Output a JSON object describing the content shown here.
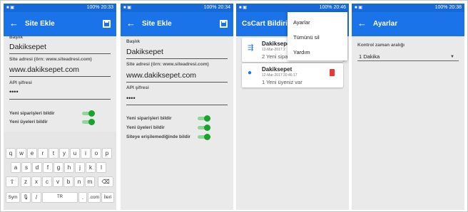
{
  "status": {
    "s1": "100% 20:33",
    "s2": "100% 20:34",
    "s3": "100% 20:46",
    "s4": "100% 20:38",
    "icons": "■ ▣"
  },
  "s1": {
    "title": "Site Ekle",
    "baslik_label": "Başlık",
    "baslik_value": "Dakiksepet",
    "adres_label": "Site adresi (örn: www.siteadresi.com)",
    "adres_value": "www.dakiksepet.com",
    "api_label": "API şifresi",
    "api_value": "••••",
    "toggles": [
      {
        "label": "Yeni siparişleri bildir",
        "on": true
      },
      {
        "label": "Yeni üyeleri bildir",
        "on": true
      }
    ],
    "keyboard": {
      "rows": [
        [
          "q",
          "w",
          "e",
          "r",
          "t",
          "y",
          "u",
          "i",
          "o",
          "p"
        ],
        [
          "a",
          "s",
          "d",
          "f",
          "g",
          "h",
          "j",
          "k",
          "l"
        ],
        [
          "z",
          "x",
          "c",
          "v",
          "b",
          "n",
          "m"
        ]
      ],
      "shift": "⇧",
      "backspace": "⌫",
      "sym": "Sym",
      "mic": "🎙",
      "slash": "/",
      "space": "TR",
      "dot": ".",
      "com": ".com",
      "next": "İleri"
    }
  },
  "s2": {
    "title": "Site Ekle",
    "baslik_label": "Başlık",
    "baslik_value": "Dakiksepet",
    "adres_label": "Site adresi (örn: www.siteadresi.com)",
    "adres_value": "www.dakiksepet.com",
    "api_label": "API şifresi",
    "api_value": "••••",
    "toggles": [
      {
        "label": "Yeni siparişleri bildir",
        "on": true
      },
      {
        "label": "Yeni üyeleri bildir",
        "on": true
      },
      {
        "label": "Siteye erişilemediğinde bildir",
        "on": true
      }
    ]
  },
  "s3": {
    "title": "CsCart Bildirimle",
    "cards": [
      {
        "name": "Dakiksepe",
        "date": "12-Mar-2017 2",
        "text": "2 Yeni sipar"
      },
      {
        "name": "Dakiksepet",
        "date": "12-Mar-2017 20:46:17",
        "text": "1 Yeni üyeniz var"
      }
    ],
    "menu": [
      "Ayarlar",
      "Tümünü sil",
      "Yardım"
    ]
  },
  "s4": {
    "title": "Ayarlar",
    "label": "Kontrol zaman aralığı",
    "value": "1 Dakika"
  }
}
